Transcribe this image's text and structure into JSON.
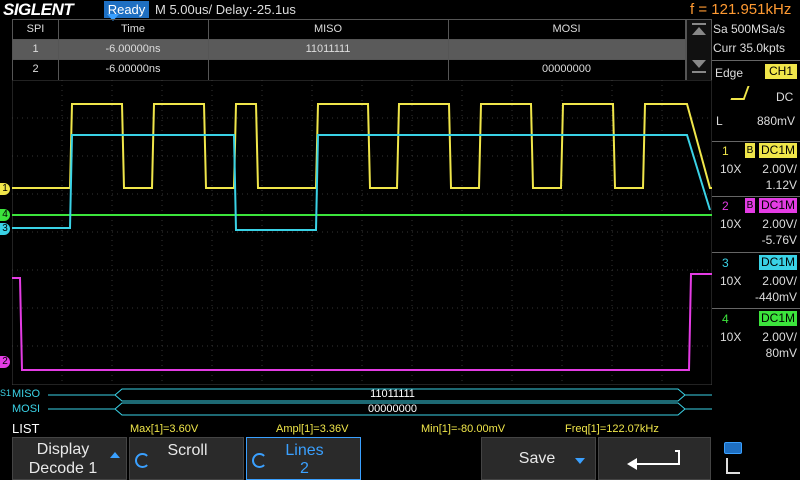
{
  "topbar": {
    "logo": "SIGLENT",
    "status": "Ready",
    "timebase": "M 5.00us/  Delay:-25.1us",
    "frequency": "f = 121.951kHz"
  },
  "decode_table": {
    "headers": [
      "SPI",
      "Time",
      "MISO",
      "MOSI"
    ],
    "rows": [
      {
        "index": "1",
        "time": "-6.00000ns",
        "miso": "11011111",
        "mosi": ""
      },
      {
        "index": "2",
        "time": "-6.00000ns",
        "miso": "",
        "mosi": "00000000"
      }
    ]
  },
  "right_panel": {
    "sample_rate": "Sa 500MSa/s",
    "memory": "Curr 35.0kpts",
    "trigger_type": "Edge",
    "trigger_source": "CH1",
    "trigger_coupling": "DC",
    "trigger_mode": "L",
    "trigger_level": "880mV",
    "channels": [
      {
        "num": "1",
        "badge": "B",
        "coupling": "DC1M",
        "probe": "10X",
        "scale": "2.00V/",
        "offset": "1.12V",
        "color": "#f0e64a"
      },
      {
        "num": "2",
        "badge": "B",
        "coupling": "DC1M",
        "probe": "10X",
        "scale": "2.00V/",
        "offset": "-5.76V",
        "color": "#e43ce4"
      },
      {
        "num": "3",
        "badge": "",
        "coupling": "DC1M",
        "probe": "10X",
        "scale": "2.00V/",
        "offset": "-440mV",
        "color": "#3ad2e6"
      },
      {
        "num": "4",
        "badge": "",
        "coupling": "DC1M",
        "probe": "10X",
        "scale": "2.00V/",
        "offset": "80mV",
        "color": "#3ce43c"
      }
    ]
  },
  "bus": {
    "marker": "S1",
    "miso_label": "MISO",
    "miso_value": "11011111",
    "mosi_label": "MOSI",
    "mosi_value": "00000000"
  },
  "measurements": {
    "mode": "LIST",
    "max": "Max[1]=3.60V",
    "ampl": "Ampl[1]=3.36V",
    "min": "Min[1]=-80.00mV",
    "freq": "Freq[1]=122.07kHz"
  },
  "softkeys": {
    "display_line1": "Display",
    "display_line2": "Decode 1",
    "scroll": "Scroll",
    "lines_line1": "Lines",
    "lines_line2": "2",
    "save": "Save"
  },
  "colors": {
    "ch1": "#f0e64a",
    "ch2": "#e43ce4",
    "ch3": "#3ad2e6",
    "ch4": "#3ce43c",
    "accent_blue": "#1e6fc2",
    "freq_orange": "#ff9a32"
  }
}
